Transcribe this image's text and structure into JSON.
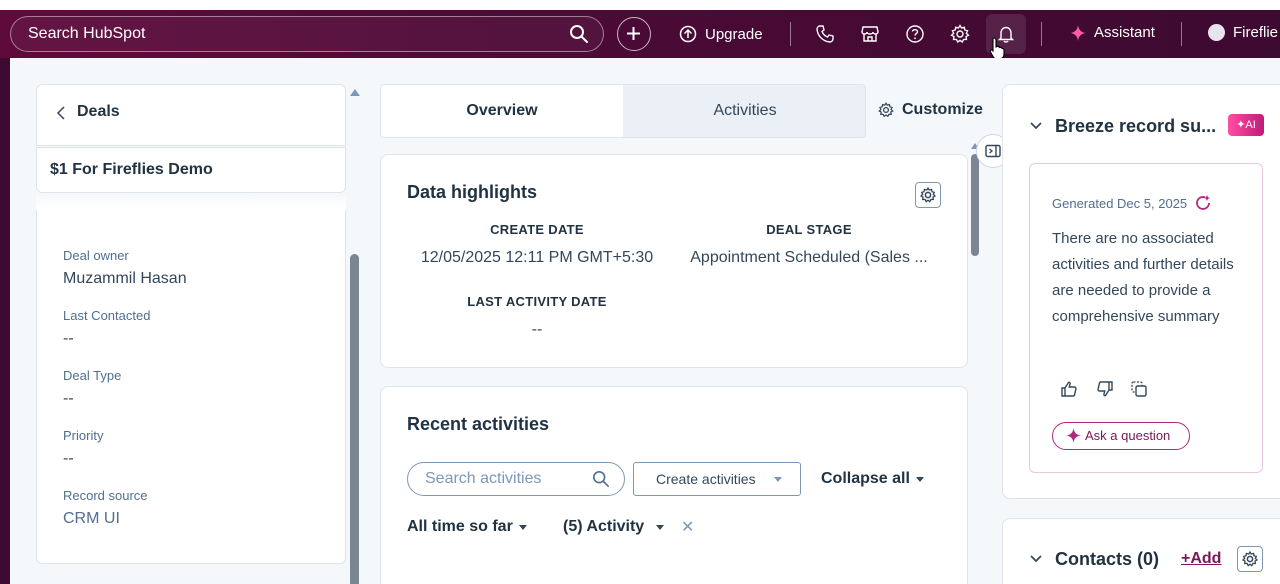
{
  "header": {
    "search_placeholder": "Search HubSpot",
    "upgrade_label": "Upgrade",
    "assistant_label": "Assistant",
    "profile_label": "Fireflie"
  },
  "breadcrumb": {
    "back_label": "Deals"
  },
  "record": {
    "name": "$1 For Fireflies Demo"
  },
  "properties": [
    {
      "label": "Deal owner",
      "value": "Muzammil Hasan"
    },
    {
      "label": "Last Contacted",
      "value": "--"
    },
    {
      "label": "Deal Type",
      "value": "--"
    },
    {
      "label": "Priority",
      "value": "--"
    },
    {
      "label": "Record source",
      "value": "CRM UI"
    }
  ],
  "tabs": [
    {
      "label": "Overview",
      "active": true
    },
    {
      "label": "Activities",
      "active": false
    }
  ],
  "customize_label": "Customize",
  "data_highlights": {
    "title": "Data highlights",
    "items": [
      {
        "label": "CREATE DATE",
        "value": "12/05/2025 12:11 PM GMT+5:30"
      },
      {
        "label": "DEAL STAGE",
        "value": "Appointment Scheduled (Sales ..."
      },
      {
        "label": "LAST ACTIVITY DATE",
        "value": "--"
      }
    ]
  },
  "recent_activities": {
    "title": "Recent activities",
    "search_placeholder": "Search activities",
    "create_label": "Create activities",
    "collapse_label": "Collapse all",
    "filter_time": "All time so far",
    "filter_activity": "(5) Activity"
  },
  "breeze": {
    "title": "Breeze record su...",
    "ai_badge": "AI",
    "generated": "Generated Dec 5, 2025",
    "summary": "There are no associated activities and further details are needed to provide a comprehensive summary",
    "ask_label": "Ask a question"
  },
  "contacts": {
    "title": "Contacts (0)",
    "add_label": "Add"
  },
  "colors": {
    "topbar": "#4a0a36",
    "accent": "#7a1757",
    "ai_badge": "#c01a7a"
  }
}
